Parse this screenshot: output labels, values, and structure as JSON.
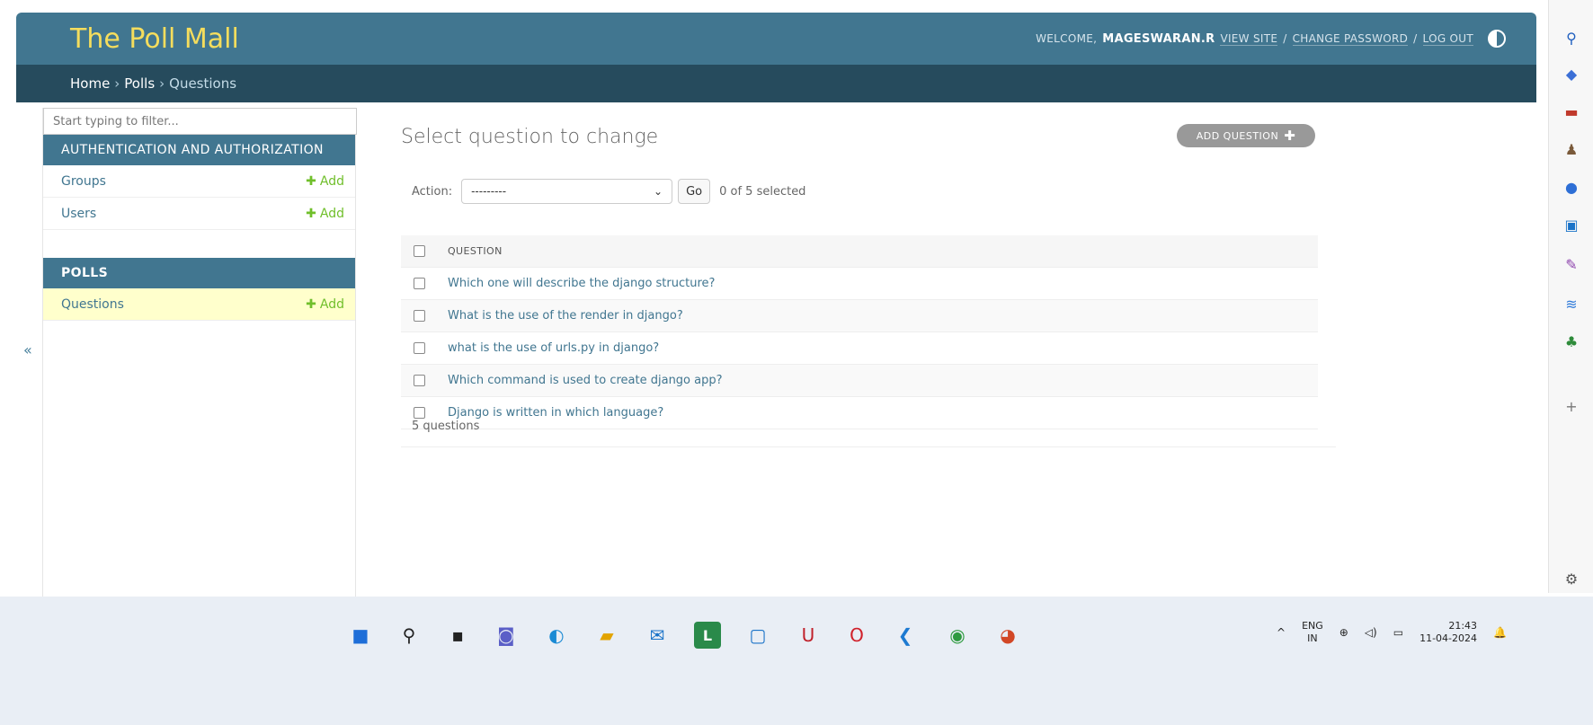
{
  "header": {
    "site_title": "The Poll Mall",
    "welcome": "WELCOME,",
    "username": "MAGESWARAN.R",
    "view_site": "VIEW SITE",
    "change_password": "CHANGE PASSWORD",
    "log_out": "LOG OUT",
    "separator": "/"
  },
  "breadcrumbs": {
    "home": "Home",
    "app": "Polls",
    "current": "Questions",
    "separator": "›"
  },
  "sidebar": {
    "filter_placeholder": "Start typing to filter...",
    "modules": [
      {
        "caption": "AUTHENTICATION AND AUTHORIZATION",
        "rows": [
          {
            "label": "Groups",
            "add": "Add"
          },
          {
            "label": "Users",
            "add": "Add"
          }
        ]
      },
      {
        "caption": "POLLS",
        "rows": [
          {
            "label": "Questions",
            "add": "Add"
          }
        ]
      }
    ],
    "toggle_label": "«"
  },
  "content": {
    "title": "Select question to change",
    "add_button": "ADD QUESTION",
    "action_label": "Action:",
    "action_selected": "---------",
    "go_button": "Go",
    "selected_count": "0 of 5 selected",
    "column_header": "QUESTION",
    "questions": [
      "Which one will describe the django structure?",
      "What is the use of the render in django?",
      "what is the use of urls.py in django?",
      "Which command is used to create django app?",
      "Django is written in which language?"
    ],
    "paginator": "5 questions"
  },
  "browser_sidebar": {
    "icons": [
      "search-icon",
      "tag-icon",
      "briefcase-icon",
      "chess-icon",
      "copilot-icon",
      "outlook-icon",
      "feather-icon",
      "wifi-icon",
      "tree-icon",
      "plus-icon",
      "settings-icon"
    ]
  },
  "taskbar": {
    "icons": [
      "windows-start-icon",
      "search-icon",
      "task-view-icon",
      "chat-icon",
      "edge-icon",
      "file-explorer-icon",
      "mail-icon",
      "l-app-icon",
      "blue-app-icon",
      "mcafee-icon",
      "opera-icon",
      "vscode-icon",
      "chrome-icon",
      "powerpoint-icon"
    ],
    "language_top": "ENG",
    "language_bottom": "IN",
    "time": "21:43",
    "date": "11-04-2024"
  },
  "colors": {
    "header_bg": "#417690",
    "breadcrumb_bg": "#264b5d",
    "site_title": "#f5dd5d",
    "link": "#417690",
    "add_green": "#70bf2b",
    "current_row_bg": "#ffffcc"
  }
}
